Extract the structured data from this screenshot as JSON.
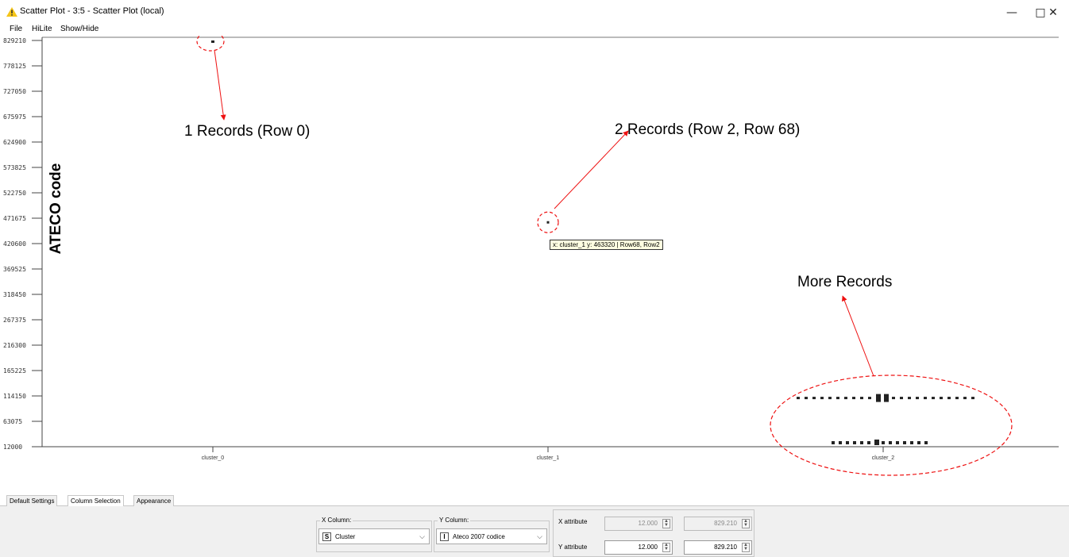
{
  "window": {
    "title": "Scatter Plot - 3:5 - Scatter Plot (local)",
    "icon": "warning-triangle-icon",
    "minimize_glyph": "—",
    "maximize_glyph": "□",
    "close_glyph": "✕"
  },
  "menu": [
    "File",
    "HiLite",
    "Show/Hide"
  ],
  "chart_data": {
    "type": "scatter",
    "ylabel": "ATECO code",
    "categories": [
      "cluster_0",
      "cluster_1",
      "cluster_2"
    ],
    "y_ticks": [
      "829210",
      "778125",
      "727050",
      "675975",
      "624900",
      "573825",
      "522750",
      "471675",
      "420600",
      "369525",
      "318450",
      "267375",
      "216300",
      "165225",
      "114150",
      "63075",
      "12000"
    ],
    "ylim": [
      12000,
      829210
    ],
    "points": [
      {
        "x": "cluster_0",
        "y": 829210
      },
      {
        "x": "cluster_1",
        "y": 463320
      },
      {
        "x": "cluster_2",
        "y": 110000
      },
      {
        "x": "cluster_2",
        "y": 20000
      }
    ],
    "annotations": [
      "1 Records (Row 0)",
      "2 Records (Row 2, Row 68)",
      "More Records"
    ],
    "tooltip": "x: cluster_1 y: 463320 | Row68, Row2",
    "accent_color": "#ee1111"
  },
  "tabs": [
    {
      "label": "Default Settings",
      "active": false
    },
    {
      "label": "Column Selection",
      "active": true
    },
    {
      "label": "Appearance",
      "active": false
    }
  ],
  "controls": {
    "x_column": {
      "legend": "X Column:",
      "type": "S",
      "value": "Cluster"
    },
    "y_column": {
      "legend": "Y Column:",
      "type": "I",
      "value": "Ateco 2007 codice"
    },
    "x_attribute": {
      "label": "X attribute",
      "min": "12.000",
      "max": "829.210"
    },
    "y_attribute": {
      "label": "Y attribute",
      "min": "12.000",
      "max": "829.210"
    }
  }
}
